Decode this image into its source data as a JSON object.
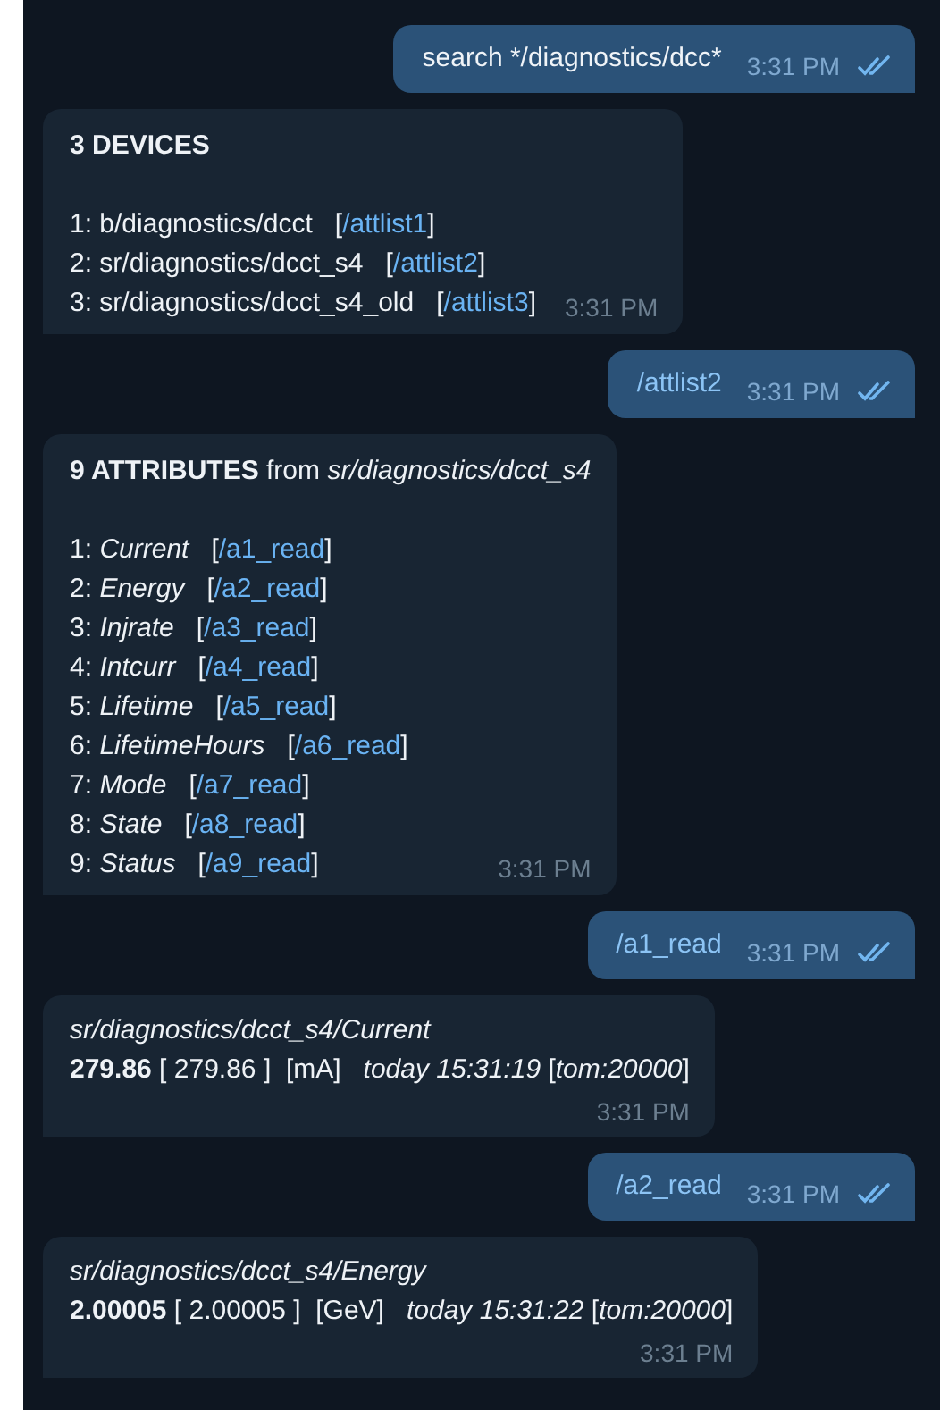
{
  "messages": [
    {
      "kind": "outgoing",
      "text": "search */diagnostics/dcc*",
      "is_command": false,
      "time": "3:31 PM",
      "read": true
    },
    {
      "kind": "list",
      "heading": "**3 DEVICES**",
      "lines": [
        {
          "prefix": "1: b/diagnostics/dcct   [",
          "command": "/attlist1",
          "suffix": "]"
        },
        {
          "prefix": "2: sr/diagnostics/dcct_s4   [",
          "command": "/attlist2",
          "suffix": "]"
        },
        {
          "prefix": "3: sr/diagnostics/dcct_s4_old   [",
          "command": "/attlist3",
          "suffix": "]"
        }
      ],
      "time": "3:31 PM"
    },
    {
      "kind": "outgoing",
      "text": "/attlist2",
      "is_command": true,
      "time": "3:31 PM",
      "read": true
    },
    {
      "kind": "list",
      "heading": "**9 ATTRIBUTES** from *sr/diagnostics/dcct_s4*",
      "lines": [
        {
          "prefix": "1: *Current*   [",
          "command": "/a1_read",
          "suffix": "]"
        },
        {
          "prefix": "2: *Energy*   [",
          "command": "/a2_read",
          "suffix": "]"
        },
        {
          "prefix": "3: *Injrate*   [",
          "command": "/a3_read",
          "suffix": "]"
        },
        {
          "prefix": "4: *Intcurr*   [",
          "command": "/a4_read",
          "suffix": "]"
        },
        {
          "prefix": "5: *Lifetime*   [",
          "command": "/a5_read",
          "suffix": "]"
        },
        {
          "prefix": "6: *LifetimeHours*   [",
          "command": "/a6_read",
          "suffix": "]"
        },
        {
          "prefix": "7: *Mode*   [",
          "command": "/a7_read",
          "suffix": "]"
        },
        {
          "prefix": "8: *State*   [",
          "command": "/a8_read",
          "suffix": "]"
        },
        {
          "prefix": "9: *Status*   [",
          "command": "/a9_read",
          "suffix": "]"
        }
      ],
      "time": "3:31 PM"
    },
    {
      "kind": "outgoing",
      "text": "/a1_read",
      "is_command": true,
      "time": "3:31 PM",
      "read": true
    },
    {
      "kind": "reading",
      "path": "sr/diagnostics/dcct_s4/Current",
      "value": "**279.86** [ 279.86 ]  [mA]   *today 15:31:19* [*tom:20000*]",
      "time": "3:31 PM"
    },
    {
      "kind": "outgoing",
      "text": "/a2_read",
      "is_command": true,
      "time": "3:31 PM",
      "read": true
    },
    {
      "kind": "reading",
      "path": "sr/diagnostics/dcct_s4/Energy",
      "value": "**2.00005** [ 2.00005 ]  [GeV]   *today 15:31:22* [*tom:20000*]",
      "time": "3:31 PM"
    }
  ]
}
